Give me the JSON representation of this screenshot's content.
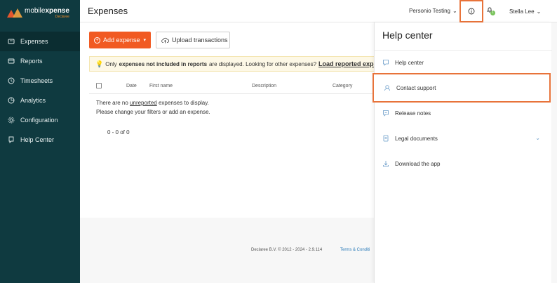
{
  "sidebar": {
    "logo": {
      "brand_light": "mobile",
      "brand_bold": "xpense",
      "sub": "Declaree"
    },
    "items": [
      {
        "label": "Expenses",
        "icon": "expenses-icon",
        "active": true
      },
      {
        "label": "Reports",
        "icon": "reports-icon",
        "active": false
      },
      {
        "label": "Timesheets",
        "icon": "clock-icon",
        "active": false
      },
      {
        "label": "Analytics",
        "icon": "analytics-icon",
        "active": false
      },
      {
        "label": "Configuration",
        "icon": "gear-icon",
        "active": false
      },
      {
        "label": "Help Center",
        "icon": "help-icon",
        "active": false
      }
    ]
  },
  "header": {
    "title": "Expenses",
    "company": "Personio Testing",
    "user": "Stella Lee",
    "notification_count": "1"
  },
  "toolbar": {
    "add_expense": "Add expense",
    "upload_transactions": "Upload transactions"
  },
  "notice": {
    "prefix": "Only",
    "bold": "expenses not included in reports",
    "middle": "are displayed. Looking for other expenses?",
    "link": "Load reported expenses"
  },
  "table": {
    "columns": [
      "Date",
      "First name",
      "Description",
      "Category"
    ]
  },
  "empty_state": {
    "line1_prefix": "There are no",
    "line1_link": "unreported",
    "line1_suffix": "expenses to display.",
    "line2": "Please change your filters or add an expense."
  },
  "pager": "0 - 0 of 0",
  "footer": {
    "copyright": "Declaree B.V. © 2012 - 2024 - 2.9.114",
    "terms": "Terms & Conditi"
  },
  "help_panel": {
    "title": "Help center",
    "items": [
      {
        "label": "Help center",
        "icon": "chat-icon"
      },
      {
        "label": "Contact support",
        "icon": "support-agent-icon"
      },
      {
        "label": "Release notes",
        "icon": "release-notes-icon"
      },
      {
        "label": "Legal documents",
        "icon": "document-icon"
      },
      {
        "label": "Download the app",
        "icon": "download-icon"
      }
    ]
  },
  "colors": {
    "sidebar_bg": "#0f3a40",
    "accent": "#f15a22",
    "highlight_border": "#e8733a"
  }
}
